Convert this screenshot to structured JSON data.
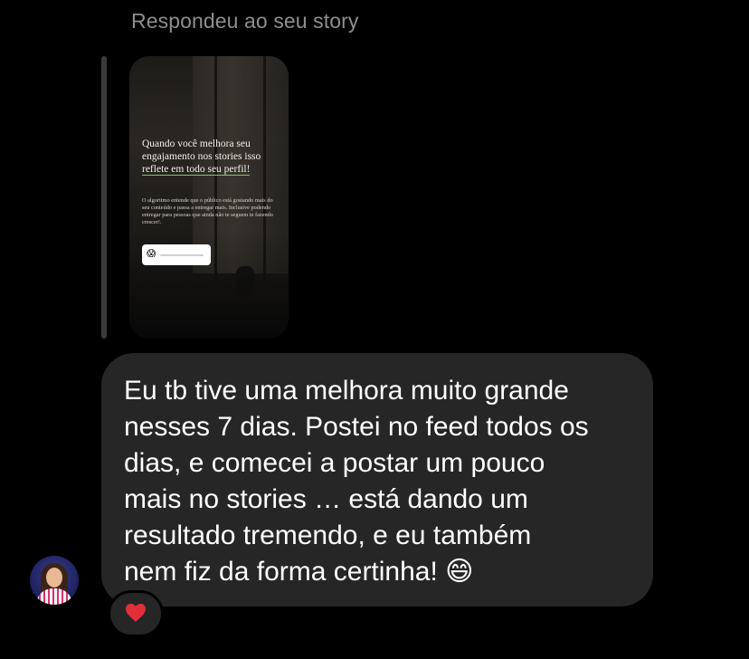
{
  "story_reply": {
    "header": "Respondeu ao seu story",
    "story": {
      "title_line": "Quando você melhora seu engajamento nos stories isso ",
      "title_accent": "reflete em todo seu perfil!",
      "body": "O algoritmo entende que o público está gostando mais do seu conteúdo e passa a entregar mais. Inclusive podendo entregar para pessoas que ainda não te seguem te fazendo crescer!.",
      "slider_emoji": "😱"
    }
  },
  "message": {
    "text": "Eu tb tive uma melhora muito grande\nnesses 7 dias. Postei no feed todos os\ndias, e comecei a postar um pouco\nmais no stories … está dando um\nresultado tremendo, e eu também\nnem fiz da forma certinha! 😄"
  },
  "reaction": {
    "icon": "heart-icon",
    "color": "#e02f3a"
  },
  "colors": {
    "background": "#000000",
    "bubble": "#262626",
    "header_text": "#8e8e8e",
    "reply_bar": "#3a3a3c"
  }
}
